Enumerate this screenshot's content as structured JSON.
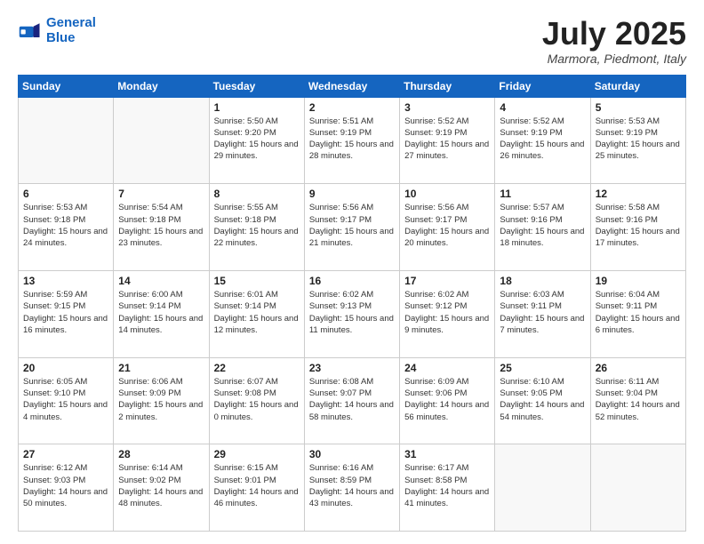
{
  "logo": {
    "line1": "General",
    "line2": "Blue"
  },
  "title": "July 2025",
  "subtitle": "Marmora, Piedmont, Italy",
  "weekdays": [
    "Sunday",
    "Monday",
    "Tuesday",
    "Wednesday",
    "Thursday",
    "Friday",
    "Saturday"
  ],
  "days": [
    {
      "num": "",
      "sunrise": "",
      "sunset": "",
      "daylight": ""
    },
    {
      "num": "",
      "sunrise": "",
      "sunset": "",
      "daylight": ""
    },
    {
      "num": "1",
      "sunrise": "5:50 AM",
      "sunset": "9:20 PM",
      "daylight": "15 hours and 29 minutes."
    },
    {
      "num": "2",
      "sunrise": "5:51 AM",
      "sunset": "9:19 PM",
      "daylight": "15 hours and 28 minutes."
    },
    {
      "num": "3",
      "sunrise": "5:52 AM",
      "sunset": "9:19 PM",
      "daylight": "15 hours and 27 minutes."
    },
    {
      "num": "4",
      "sunrise": "5:52 AM",
      "sunset": "9:19 PM",
      "daylight": "15 hours and 26 minutes."
    },
    {
      "num": "5",
      "sunrise": "5:53 AM",
      "sunset": "9:19 PM",
      "daylight": "15 hours and 25 minutes."
    },
    {
      "num": "6",
      "sunrise": "5:53 AM",
      "sunset": "9:18 PM",
      "daylight": "15 hours and 24 minutes."
    },
    {
      "num": "7",
      "sunrise": "5:54 AM",
      "sunset": "9:18 PM",
      "daylight": "15 hours and 23 minutes."
    },
    {
      "num": "8",
      "sunrise": "5:55 AM",
      "sunset": "9:18 PM",
      "daylight": "15 hours and 22 minutes."
    },
    {
      "num": "9",
      "sunrise": "5:56 AM",
      "sunset": "9:17 PM",
      "daylight": "15 hours and 21 minutes."
    },
    {
      "num": "10",
      "sunrise": "5:56 AM",
      "sunset": "9:17 PM",
      "daylight": "15 hours and 20 minutes."
    },
    {
      "num": "11",
      "sunrise": "5:57 AM",
      "sunset": "9:16 PM",
      "daylight": "15 hours and 18 minutes."
    },
    {
      "num": "12",
      "sunrise": "5:58 AM",
      "sunset": "9:16 PM",
      "daylight": "15 hours and 17 minutes."
    },
    {
      "num": "13",
      "sunrise": "5:59 AM",
      "sunset": "9:15 PM",
      "daylight": "15 hours and 16 minutes."
    },
    {
      "num": "14",
      "sunrise": "6:00 AM",
      "sunset": "9:14 PM",
      "daylight": "15 hours and 14 minutes."
    },
    {
      "num": "15",
      "sunrise": "6:01 AM",
      "sunset": "9:14 PM",
      "daylight": "15 hours and 12 minutes."
    },
    {
      "num": "16",
      "sunrise": "6:02 AM",
      "sunset": "9:13 PM",
      "daylight": "15 hours and 11 minutes."
    },
    {
      "num": "17",
      "sunrise": "6:02 AM",
      "sunset": "9:12 PM",
      "daylight": "15 hours and 9 minutes."
    },
    {
      "num": "18",
      "sunrise": "6:03 AM",
      "sunset": "9:11 PM",
      "daylight": "15 hours and 7 minutes."
    },
    {
      "num": "19",
      "sunrise": "6:04 AM",
      "sunset": "9:11 PM",
      "daylight": "15 hours and 6 minutes."
    },
    {
      "num": "20",
      "sunrise": "6:05 AM",
      "sunset": "9:10 PM",
      "daylight": "15 hours and 4 minutes."
    },
    {
      "num": "21",
      "sunrise": "6:06 AM",
      "sunset": "9:09 PM",
      "daylight": "15 hours and 2 minutes."
    },
    {
      "num": "22",
      "sunrise": "6:07 AM",
      "sunset": "9:08 PM",
      "daylight": "15 hours and 0 minutes."
    },
    {
      "num": "23",
      "sunrise": "6:08 AM",
      "sunset": "9:07 PM",
      "daylight": "14 hours and 58 minutes."
    },
    {
      "num": "24",
      "sunrise": "6:09 AM",
      "sunset": "9:06 PM",
      "daylight": "14 hours and 56 minutes."
    },
    {
      "num": "25",
      "sunrise": "6:10 AM",
      "sunset": "9:05 PM",
      "daylight": "14 hours and 54 minutes."
    },
    {
      "num": "26",
      "sunrise": "6:11 AM",
      "sunset": "9:04 PM",
      "daylight": "14 hours and 52 minutes."
    },
    {
      "num": "27",
      "sunrise": "6:12 AM",
      "sunset": "9:03 PM",
      "daylight": "14 hours and 50 minutes."
    },
    {
      "num": "28",
      "sunrise": "6:14 AM",
      "sunset": "9:02 PM",
      "daylight": "14 hours and 48 minutes."
    },
    {
      "num": "29",
      "sunrise": "6:15 AM",
      "sunset": "9:01 PM",
      "daylight": "14 hours and 46 minutes."
    },
    {
      "num": "30",
      "sunrise": "6:16 AM",
      "sunset": "8:59 PM",
      "daylight": "14 hours and 43 minutes."
    },
    {
      "num": "31",
      "sunrise": "6:17 AM",
      "sunset": "8:58 PM",
      "daylight": "14 hours and 41 minutes."
    },
    {
      "num": "",
      "sunrise": "",
      "sunset": "",
      "daylight": ""
    },
    {
      "num": "",
      "sunrise": "",
      "sunset": "",
      "daylight": ""
    }
  ]
}
